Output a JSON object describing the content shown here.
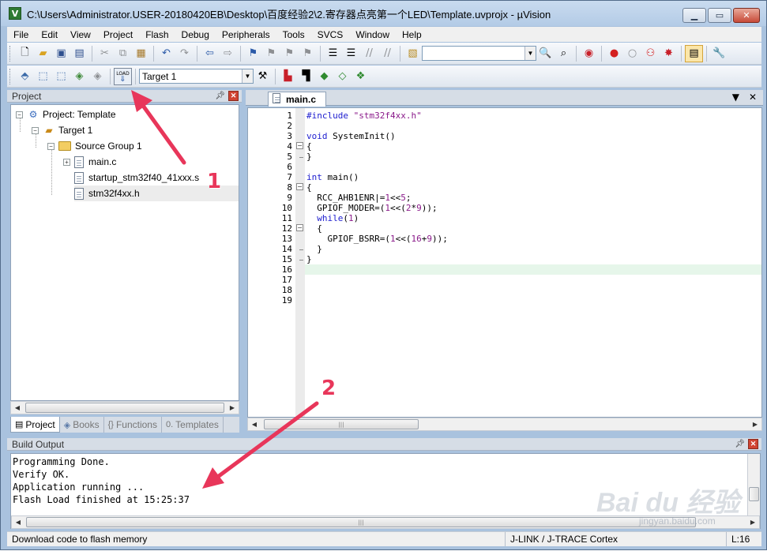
{
  "window": {
    "app_icon": "V",
    "title": "C:\\Users\\Administrator.USER-20180420EB\\Desktop\\百度经验2\\2.寄存器点亮第一个LED\\Template.uvprojx - µVision",
    "min_icon": "minimize-icon",
    "max_icon": "maximize-icon",
    "close_icon": "close-icon"
  },
  "menubar": [
    "File",
    "Edit",
    "View",
    "Project",
    "Flash",
    "Debug",
    "Peripherals",
    "Tools",
    "SVCS",
    "Window",
    "Help"
  ],
  "toolbar2": {
    "load_label": "LOAD",
    "target_value": "Target 1"
  },
  "project_panel": {
    "title": "Project",
    "tree": {
      "project": "Project: Template",
      "target": "Target 1",
      "group": "Source Group 1",
      "files": [
        "main.c",
        "startup_stm32f40_41xxx.s",
        "stm32f4xx.h"
      ]
    },
    "tabs": [
      {
        "icon": "project-icon",
        "label": "Project"
      },
      {
        "icon": "books-icon",
        "label": "Books"
      },
      {
        "icon": "functions-icon",
        "label": "Functions"
      },
      {
        "icon": "templates-icon",
        "label": "Templates"
      }
    ]
  },
  "editor": {
    "tab_label": "main.c",
    "line_numbers": [
      "1",
      "2",
      "3",
      "4",
      "5",
      "6",
      "7",
      "8",
      "9",
      "10",
      "11",
      "12",
      "13",
      "14",
      "15",
      "16",
      "17",
      "18",
      "19"
    ],
    "lines": [
      "#include \"stm32f4xx.h\"",
      "",
      "void SystemInit()",
      "{",
      "}",
      "",
      "int main()",
      "{",
      "  RCC_AHB1ENR|=1<<5;",
      "  GPIOF_MODER=(1<<(2*9));",
      "  while(1)",
      "  {",
      "    GPIOF_BSRR=(1<<(16+9));",
      "  }",
      "}",
      "",
      "",
      "",
      ""
    ]
  },
  "build_output": {
    "title": "Build Output",
    "lines": [
      "Programming Done.",
      "Verify OK.",
      "Application running ...",
      "Flash Load finished at 15:25:37"
    ]
  },
  "statusbar": {
    "message": "Download code to flash memory",
    "debugger": "J-LINK / J-TRACE Cortex",
    "line": "L:16"
  },
  "annotations": {
    "label1": "1",
    "label2": "2",
    "arrow_color": "#e8365a"
  },
  "watermark": {
    "text": "Bai du 经验",
    "url": "jingyan.baidu.com"
  }
}
